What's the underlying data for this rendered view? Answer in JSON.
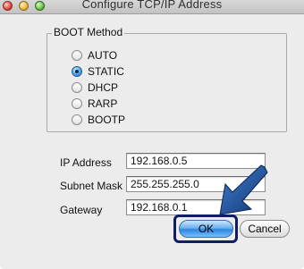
{
  "window": {
    "title": "Configure TCP/IP Address"
  },
  "boot_method": {
    "legend": "BOOT Method",
    "options": [
      {
        "label": "AUTO",
        "selected": false
      },
      {
        "label": "STATIC",
        "selected": true
      },
      {
        "label": "DHCP",
        "selected": false
      },
      {
        "label": "RARP",
        "selected": false
      },
      {
        "label": "BOOTP",
        "selected": false
      }
    ]
  },
  "fields": {
    "ip_address": {
      "label": "IP Address",
      "value": "192.168.0.5"
    },
    "subnet_mask": {
      "label": "Subnet Mask",
      "value": "255.255.255.0"
    },
    "gateway": {
      "label": "Gateway",
      "value": "192.168.0.1"
    }
  },
  "buttons": {
    "ok": "OK",
    "cancel": "Cancel"
  },
  "colors": {
    "accent": "#2f86dc",
    "highlight_arrow": "#1b4fa0",
    "highlight_border": "#101c66"
  }
}
